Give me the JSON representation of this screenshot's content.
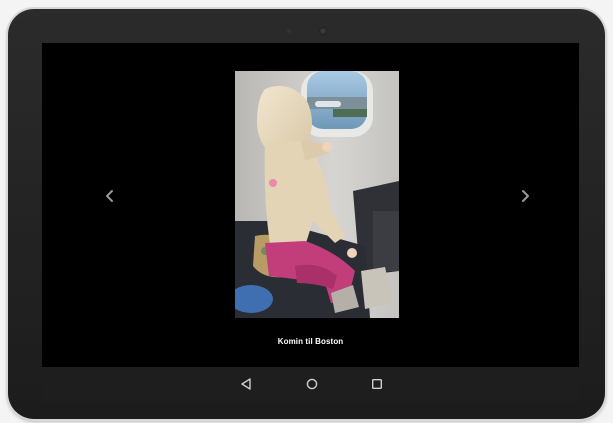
{
  "gallery": {
    "caption": "Komin til Boston",
    "prev_icon": "chevron-left-icon",
    "next_icon": "chevron-right-icon"
  },
  "photo": {
    "subject": "toddler-at-airplane-window",
    "palette": {
      "cabin_wall": "#c9c8c5",
      "window_sky": "#8fb6d4",
      "hood": "#e9dcc2",
      "pants": "#c23e7a",
      "seat": "#2a2d33"
    }
  },
  "system_nav": {
    "back_icon": "back-triangle-icon",
    "home_icon": "home-circle-icon",
    "recents_icon": "recents-square-icon"
  },
  "colors": {
    "screen_bg": "#000000",
    "bezel": "#232323",
    "nav_bar": "#1e1e1e",
    "icon": "#cfcfcf"
  }
}
